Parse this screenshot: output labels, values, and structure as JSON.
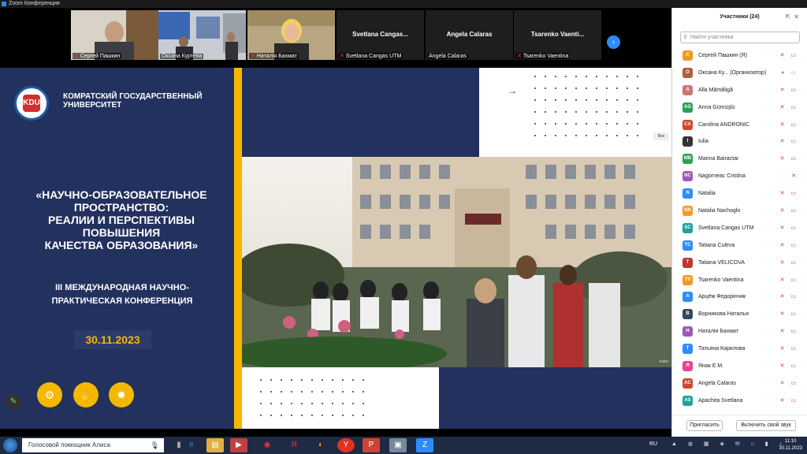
{
  "window": {
    "title": "Zoom Конференция"
  },
  "video_strip": {
    "tiles": [
      {
        "name": "Сергей Пашкин",
        "muted": true,
        "has_video": true
      },
      {
        "name": "Оксана Куртева",
        "muted": false,
        "has_video": true
      },
      {
        "name": "Наталія Бахмат",
        "muted": true,
        "has_video": true
      },
      {
        "name": "Svetlana Cangas UTM",
        "big": "Svetlana Cangas...",
        "muted": true,
        "has_video": false
      },
      {
        "name": "Angela Calaras",
        "big": "Angela Calaras",
        "muted": false,
        "has_video": false
      },
      {
        "name": "Tsarenko Vaentina",
        "big": "Tsarenko Vaenti...",
        "muted": true,
        "has_video": false
      }
    ]
  },
  "slide": {
    "university": "Комратский государственный университет",
    "logo_text": "KDU",
    "title_lines": [
      "«НАУЧНО-ОБРАЗОВАТЕЛЬНОЕ",
      "ПРОСТРАНСТВО:",
      "РЕАЛИИ И ПЕРСПЕКТИВЫ",
      "ПОВЫШЕНИЯ",
      "КАЧЕСТВА ОБРАЗОВАНИЯ»"
    ],
    "subtitle_lines": [
      "III МЕЖДУНАРОДНАЯ НАУЧНО-",
      "ПРАКТИЧЕСКАЯ КОНФЕРЕНЦИЯ"
    ],
    "date": "30.11.2023",
    "photo_caption": "nukis",
    "corner_tab": "Все"
  },
  "participants": {
    "title": "Участники (24)",
    "search_placeholder": "Найти участника",
    "list": [
      {
        "initials": "С",
        "color": "#f29a1e",
        "name": "Сергей Пашкин (Я)",
        "status": "✕ ▭"
      },
      {
        "initials": "О",
        "color": "#b05f3c",
        "name": "Оксана Ку... (Организатор)",
        "status": "● ▭",
        "grey": true
      },
      {
        "initials": "A",
        "color": "#c77",
        "name": "Alla Mămăligă",
        "status": "✕ ▭"
      },
      {
        "initials": "AG",
        "color": "#2e9e5b",
        "name": "Anna Gümüşlü",
        "status": "✕ ▭"
      },
      {
        "initials": "CA",
        "color": "#d2462d",
        "name": "Carolina ANDRONIC",
        "status": "✕ ▭"
      },
      {
        "initials": "I",
        "color": "#333",
        "name": "Iulia",
        "status": "✕ ▭"
      },
      {
        "initials": "MB",
        "color": "#2e9e5b",
        "name": "Marina Bairactar",
        "status": "✕ ▭"
      },
      {
        "initials": "NC",
        "color": "#9b59b6",
        "name": "Nagorneac Cristina",
        "status": "✕"
      },
      {
        "initials": "N",
        "color": "#2d8cff",
        "name": "Natalia",
        "status": "✕ ▭"
      },
      {
        "initials": "NN",
        "color": "#f29a1e",
        "name": "Natalia Nachoglo",
        "status": "✕ ▭"
      },
      {
        "initials": "SC",
        "color": "#1ba39c",
        "name": "Svetlana Cangas UTM",
        "status": "✕ ▭"
      },
      {
        "initials": "TC",
        "color": "#2d8cff",
        "name": "Tatiana Culeva",
        "status": "✕ ▭"
      },
      {
        "initials": "T",
        "color": "#c0392b",
        "name": "Tatiana VELICOVA",
        "status": "✕ ▭"
      },
      {
        "initials": "TV",
        "color": "#f29a1e",
        "name": "Tsarenko Vaentina",
        "status": "✕ ▭"
      },
      {
        "initials": "А",
        "color": "#2d8cff",
        "name": "Арцём Федорінчик",
        "status": "✕ ▭"
      },
      {
        "initials": "В",
        "color": "#34495e",
        "name": "Ворникова Наталья",
        "status": "✕ ▭"
      },
      {
        "initials": "Н",
        "color": "#9b59b6",
        "name": "Наталія Бахмат",
        "status": "✕ ▭"
      },
      {
        "initials": "Т",
        "color": "#2d8cff",
        "name": "Татьяна Кирилова",
        "status": "✕ ▭"
      },
      {
        "initials": "Я",
        "color": "#e84393",
        "name": "Янак Е.М.",
        "status": "✕ ▭"
      },
      {
        "initials": "AC",
        "color": "#d2462d",
        "name": "Angela Calaras",
        "status": "✕ ▭"
      },
      {
        "initials": "AS",
        "color": "#1ba39c",
        "name": "Apachita Svetlana",
        "status": "✕ ▭"
      }
    ],
    "invite_label": "Пригласить",
    "unmute_label": "Включить свой звук"
  },
  "taskbar": {
    "search_text": "Голосовой помощник Алиса",
    "lang": "RU",
    "time": "11:10",
    "date": "30.11.2023"
  }
}
